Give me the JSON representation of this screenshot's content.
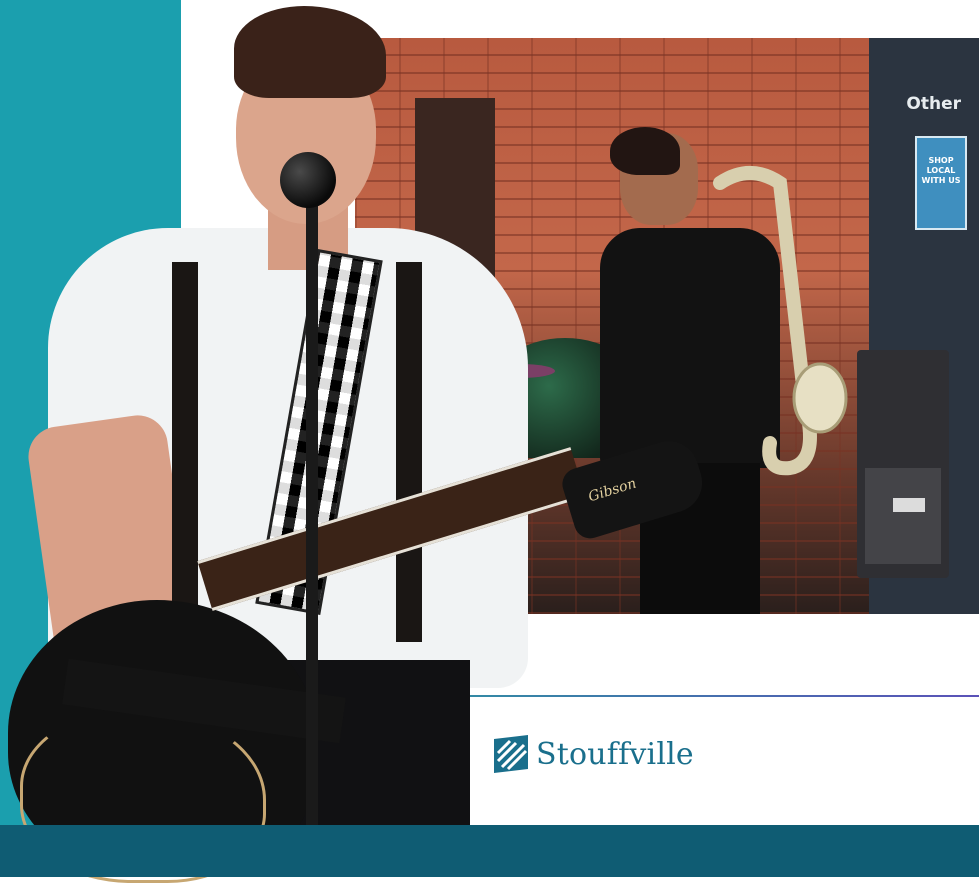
{
  "colors": {
    "teal_band": "#1b9fae",
    "bottom_bar": "#0f5c73",
    "brand_text": "#1a6f8c",
    "divider": "#5b52b8"
  },
  "photo": {
    "shop_sign": "Other",
    "shop_poster": "SHOP LOCAL WITH US",
    "guitar_logo": "Gibson"
  },
  "brand": {
    "name": "Stouffville",
    "logo_icon": "stouffville-leaf-logo-icon"
  }
}
